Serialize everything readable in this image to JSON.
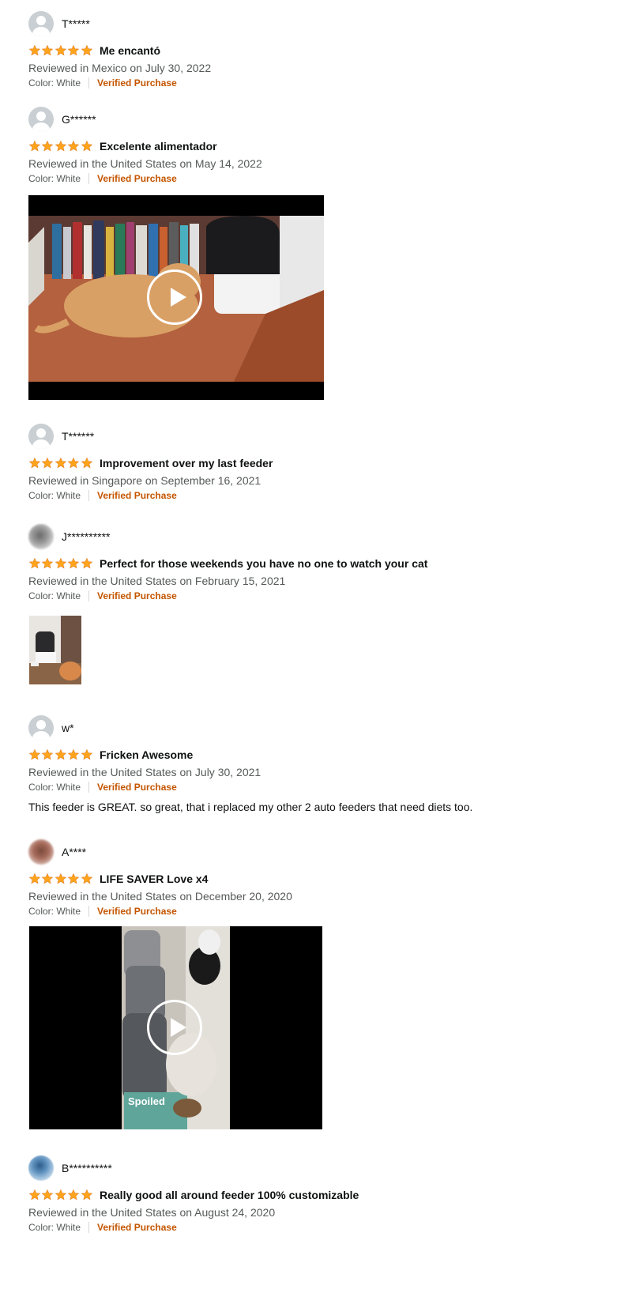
{
  "reviews": [
    {
      "author": "T*****",
      "title": "Me encantó",
      "meta": "Reviewed in Mexico on July 30, 2022",
      "color": "Color: White",
      "verified": "Verified Purchase"
    },
    {
      "author": "G******",
      "title": "Excelente alimentador",
      "meta": "Reviewed in the United States on May 14, 2022",
      "color": "Color: White",
      "verified": "Verified Purchase",
      "media": "video"
    },
    {
      "author": "T******",
      "title": "Improvement over my last feeder",
      "meta": "Reviewed in Singapore on September 16, 2021",
      "color": "Color: White",
      "verified": "Verified Purchase"
    },
    {
      "author": "J**********",
      "title": "Perfect for those weekends you have no one to watch your cat",
      "meta": "Reviewed in the United States on February 15, 2021",
      "color": "Color: White",
      "verified": "Verified Purchase",
      "media": "image"
    },
    {
      "author": "w*",
      "title": "Fricken Awesome",
      "meta": "Reviewed in the United States on July 30, 2021",
      "color": "Color: White",
      "verified": "Verified Purchase",
      "body": "This feeder is GREAT. so great, that i replaced my other 2 auto feeders that need diets too."
    },
    {
      "author": "A****",
      "title": "LIFE SAVER Love x4",
      "meta": "Reviewed in the United States on December 20, 2020",
      "color": "Color: White",
      "verified": "Verified Purchase",
      "media": "video",
      "video_caption": "Spoiled"
    },
    {
      "author": "B**********",
      "title": "Really good all around feeder 100% customizable",
      "meta": "Reviewed in the United States on August 24, 2020",
      "color": "Color: White",
      "verified": "Verified Purchase"
    }
  ],
  "rating": 5,
  "colors": {
    "star": "#ffa41c",
    "verified": "#c45500",
    "meta": "#565959",
    "text": "#0f1111"
  }
}
